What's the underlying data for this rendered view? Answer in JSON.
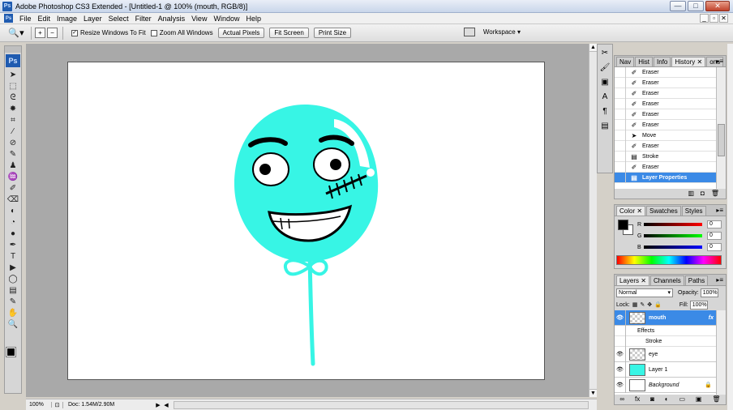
{
  "window": {
    "title": "Adobe Photoshop CS3 Extended - [Untitled-1 @ 100% (mouth, RGB/8)]",
    "badge": "Ps",
    "min_label": "—",
    "max_label": "□",
    "close_label": "✕"
  },
  "menu": [
    "File",
    "Edit",
    "Image",
    "Layer",
    "Select",
    "Filter",
    "Analysis",
    "View",
    "Window",
    "Help"
  ],
  "doc_controls": [
    "_",
    "▫",
    "✕"
  ],
  "options": {
    "resize_windows": "Resize Windows To Fit",
    "zoom_all": "Zoom All Windows",
    "actual_pixels": "Actual Pixels",
    "fit_screen": "Fit Screen",
    "print_size": "Print Size",
    "workspace": "Workspace ▾"
  },
  "tools": {
    "logo": "Ps",
    "glyphs": [
      "➤",
      "⬚",
      "ᘓ",
      "✸",
      "⌗",
      "⁄",
      "⊘",
      "✎",
      "♟",
      "♒",
      "✐",
      "⌫",
      "◐",
      "◔",
      "●",
      "✒",
      "T",
      "▶",
      "◯",
      "▤",
      "✎",
      "✋",
      "🔍"
    ]
  },
  "status": {
    "zoom": "100%",
    "doc": "Doc: 1.54M/2.90M"
  },
  "history": {
    "tabs": [
      "Nav",
      "Hist",
      "Info",
      "History",
      "ons"
    ],
    "active_tab": "History ✕",
    "rows": [
      {
        "label": "Eraser",
        "icon": "✐"
      },
      {
        "label": "Eraser",
        "icon": "✐"
      },
      {
        "label": "Eraser",
        "icon": "✐"
      },
      {
        "label": "Eraser",
        "icon": "✐"
      },
      {
        "label": "Eraser",
        "icon": "✐"
      },
      {
        "label": "Eraser",
        "icon": "✐"
      },
      {
        "label": "Move",
        "icon": "➤"
      },
      {
        "label": "Eraser",
        "icon": "✐"
      },
      {
        "label": "Stroke",
        "icon": "▤"
      },
      {
        "label": "Eraser",
        "icon": "✐"
      },
      {
        "label": "Layer Properties",
        "icon": "▤"
      }
    ]
  },
  "color": {
    "tabs": [
      "Color ✕",
      "Swatches",
      "Styles"
    ],
    "channels": [
      {
        "name": "R",
        "value": "0",
        "track": "#d63030"
      },
      {
        "name": "G",
        "value": "0",
        "track": "#30b030"
      },
      {
        "name": "B",
        "value": "0",
        "track": "#3040d0"
      }
    ]
  },
  "layers": {
    "tabs": [
      "Layers ✕",
      "Channels",
      "Paths"
    ],
    "blend": "Normal",
    "opacity_label": "Opacity:",
    "opacity": "100%",
    "lock_label": "Lock:",
    "fill_label": "Fill:",
    "fill": "100%",
    "effects_label": "Effects",
    "stroke_label": "Stroke",
    "items": [
      "mouth",
      "eye",
      "Layer 1",
      "Background"
    ],
    "fx": "fx"
  },
  "colors": {
    "cyan": "#37f5e5",
    "selection": "#3b8ae6"
  }
}
